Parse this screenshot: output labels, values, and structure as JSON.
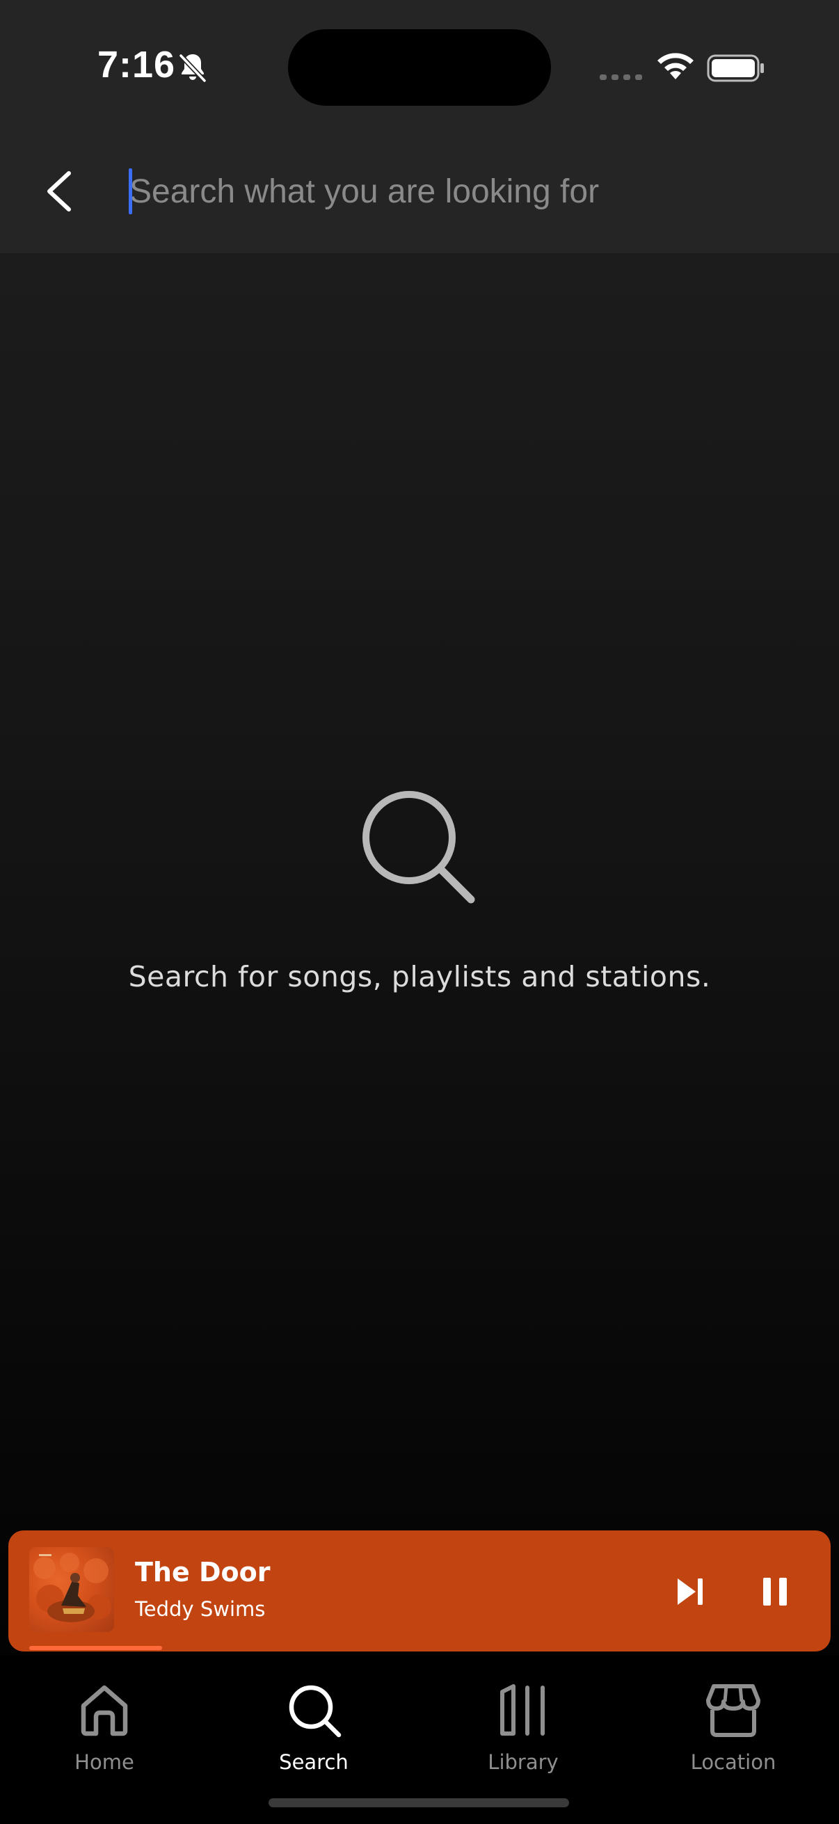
{
  "status_bar": {
    "time": "7:16",
    "icons": [
      "bell-slash-icon",
      "cellular-signal-icon",
      "wifi-icon",
      "battery-icon"
    ]
  },
  "search": {
    "placeholder": "Search what you are looking for",
    "value": ""
  },
  "empty_state": {
    "icon": "search-icon",
    "message": "Search for songs, playlists and stations."
  },
  "now_playing": {
    "title": "The Door",
    "artist": "Teddy Swims",
    "progress": 0.17,
    "state": "playing",
    "color": "#c24511",
    "progress_color": "#ff6a3a"
  },
  "nav": {
    "items": [
      {
        "label": "Home",
        "icon": "home-icon",
        "active": false
      },
      {
        "label": "Search",
        "icon": "search-icon",
        "active": true
      },
      {
        "label": "Library",
        "icon": "library-icon",
        "active": false
      },
      {
        "label": "Location",
        "icon": "store-icon",
        "active": false
      }
    ]
  },
  "colors": {
    "background": "#1c1c1c",
    "caret": "#3b6ef5",
    "inactive_nav": "#8f8f8f",
    "active_nav": "#ffffff"
  }
}
